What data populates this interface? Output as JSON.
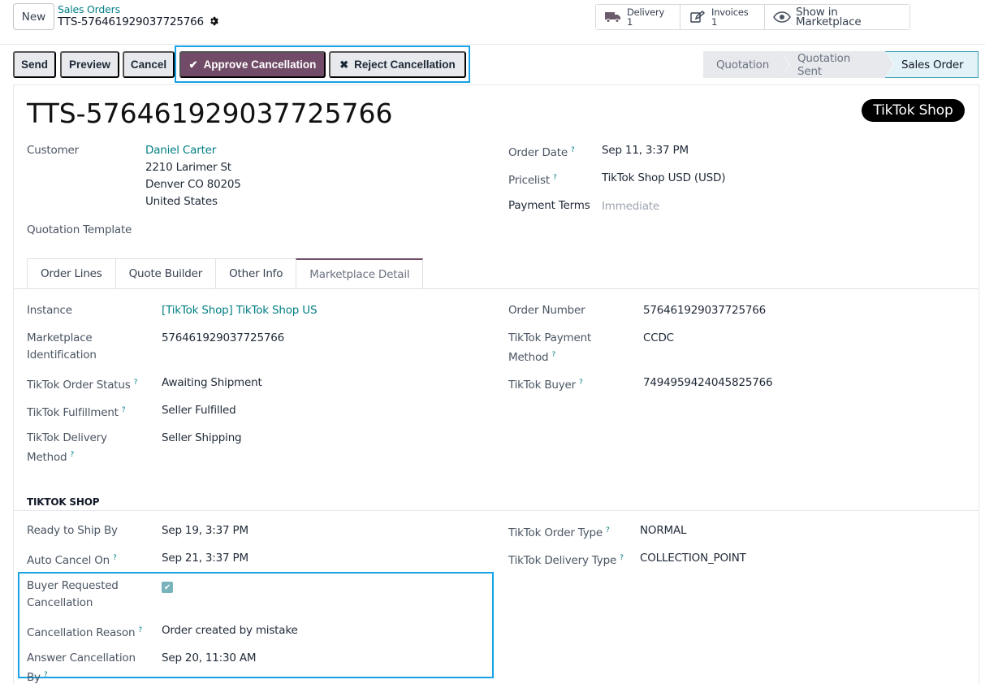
{
  "header": {
    "new_label": "New",
    "breadcrumb_parent": "Sales Orders",
    "breadcrumb_current": "TTS-576461929037725766",
    "smart_buttons": [
      {
        "label": "Delivery",
        "count": "1",
        "icon": "truck-icon"
      },
      {
        "label": "Invoices",
        "count": "1",
        "icon": "invoice-edit-icon"
      },
      {
        "label": "Show in Marketplace",
        "icon": "eye-icon"
      }
    ]
  },
  "actions": {
    "send": "Send",
    "preview": "Preview",
    "cancel": "Cancel",
    "approve_cancellation": "Approve Cancellation",
    "reject_cancellation": "Reject Cancellation"
  },
  "statusbar": [
    "Quotation",
    "Quotation Sent",
    "Sales Order"
  ],
  "statusbar_active": "Sales Order",
  "record": {
    "title": "TTS-576461929037725766",
    "badge": "TikTok Shop",
    "customer_label": "Customer",
    "customer_name": "Daniel Carter",
    "address": [
      "2210 Larimer St",
      "Denver CO 80205",
      "United States"
    ],
    "quotation_template_label": "Quotation Template",
    "order_date_label": "Order Date",
    "order_date": "Sep 11, 3:37 PM",
    "pricelist_label": "Pricelist",
    "pricelist": "TikTok Shop USD (USD)",
    "payment_terms_label": "Payment Terms",
    "payment_terms": "Immediate"
  },
  "tabs": [
    "Order Lines",
    "Quote Builder",
    "Other Info",
    "Marketplace Detail"
  ],
  "active_tab": "Marketplace Detail",
  "marketplace": {
    "instance_label": "Instance",
    "instance": "[TikTok Shop] TikTok Shop US",
    "marketplace_id_label_1": "Marketplace",
    "marketplace_id_label_2": "Identification",
    "marketplace_id": "576461929037725766",
    "order_status_label": "TikTok Order Status",
    "order_status": "Awaiting Shipment",
    "fulfillment_label": "TikTok Fulfillment",
    "fulfillment": "Seller Fulfilled",
    "delivery_method_label_1": "TikTok Delivery",
    "delivery_method_label_2": "Method",
    "delivery_method": "Seller Shipping",
    "order_number_label": "Order Number",
    "order_number": "576461929037725766",
    "payment_method_label_1": "TikTok Payment",
    "payment_method_label_2": "Method",
    "payment_method": "CCDC",
    "buyer_label": "TikTok Buyer",
    "buyer": "7494959424045825766"
  },
  "tiktok_shop": {
    "group_title": "TIKTOK SHOP",
    "ready_to_ship_label": "Ready to Ship By",
    "ready_to_ship": "Sep 19, 3:37 PM",
    "auto_cancel_label": "Auto Cancel On",
    "auto_cancel": "Sep 21, 3:37 PM",
    "buyer_requested_label_1": "Buyer Requested",
    "buyer_requested_label_2": "Cancellation",
    "buyer_requested_cancellation": true,
    "cancellation_reason_label": "Cancellation Reason",
    "cancellation_reason": "Order created by mistake",
    "answer_by_label_1": "Answer Cancellation",
    "answer_by_label_2": "By",
    "answer_by": "Sep 20, 11:30 AM",
    "order_type_label": "TikTok Order Type",
    "order_type": "NORMAL",
    "delivery_type_label": "TikTok Delivery Type",
    "delivery_type": "COLLECTION_POINT"
  },
  "help_marker": "?",
  "colors": {
    "accent": "#714b67",
    "link": "#017e84",
    "highlight": "#17a2e6"
  }
}
